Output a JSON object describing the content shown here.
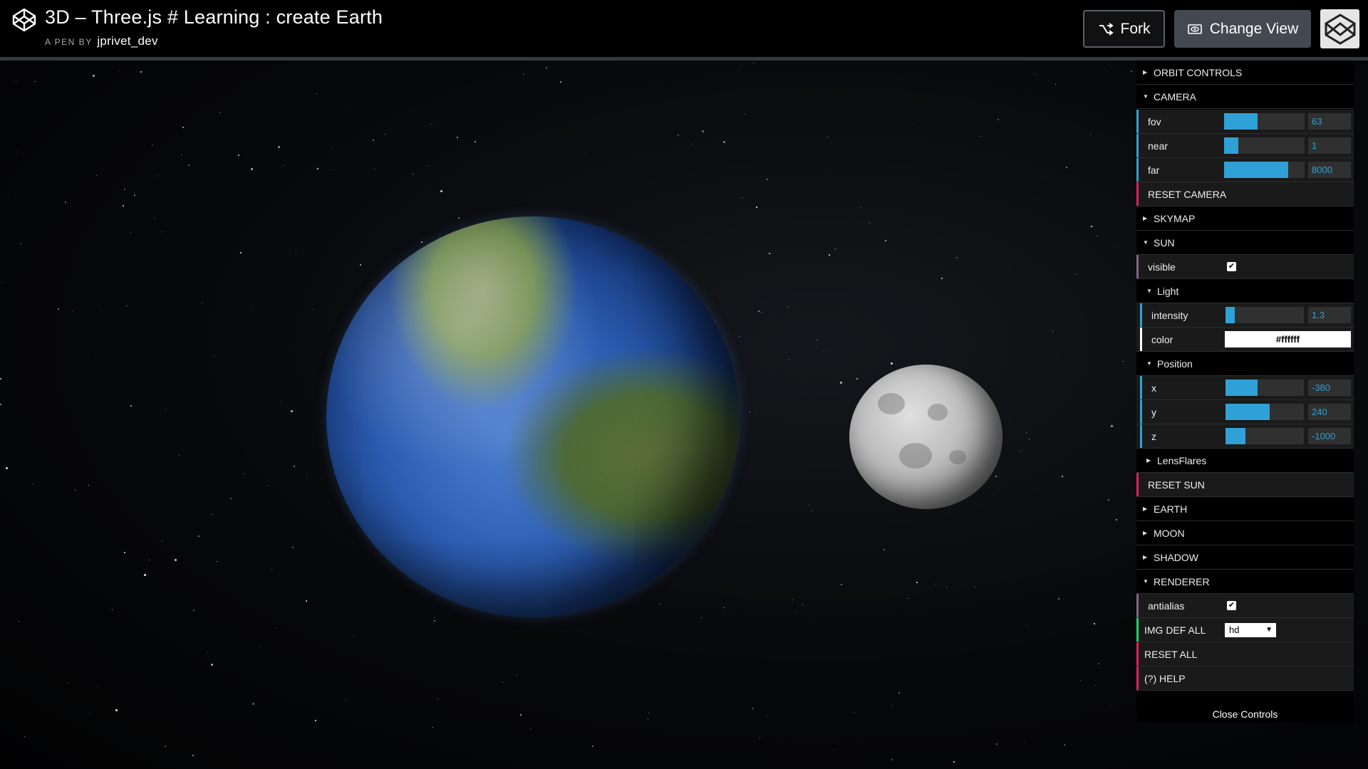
{
  "header": {
    "title": "3D – Three.js # Learning : create Earth",
    "byline_prefix": "A PEN BY",
    "author": "jprivet_dev",
    "fork_label": "Fork",
    "change_view_label": "Change View"
  },
  "gui": {
    "orbit_controls": "ORBIT CONTROLS",
    "camera": {
      "title": "CAMERA",
      "fov": {
        "label": "fov",
        "value": "63",
        "fill": 0.42
      },
      "near": {
        "label": "near",
        "value": "1",
        "fill": 0.18
      },
      "far": {
        "label": "far",
        "value": "8000",
        "fill": 0.8
      },
      "reset": "RESET CAMERA"
    },
    "skymap": "SKYMAP",
    "sun": {
      "title": "SUN",
      "visible": {
        "label": "visible",
        "checked": true
      },
      "light": {
        "title": "Light",
        "intensity": {
          "label": "intensity",
          "value": "1.3",
          "fill": 0.12
        },
        "color": {
          "label": "color",
          "value": "#ffffff"
        }
      },
      "position": {
        "title": "Position",
        "x": {
          "label": "x",
          "value": "-380",
          "fill": 0.41
        },
        "y": {
          "label": "y",
          "value": "240",
          "fill": 0.56
        },
        "z": {
          "label": "z",
          "value": "-1000",
          "fill": 0.25
        }
      },
      "lensflares": "LensFlares",
      "reset": "RESET SUN"
    },
    "earth": "EARTH",
    "moon": "MOON",
    "shadow": "SHADOW",
    "renderer": {
      "title": "RENDERER",
      "antialias": {
        "label": "antialias",
        "checked": true
      }
    },
    "img_def_all": {
      "label": "IMG DEF ALL",
      "value": "hd"
    },
    "reset_all": "RESET ALL",
    "help": "(?) HELP",
    "close": "Close Controls"
  },
  "colors": {
    "accent_blue": "#2fa1d6",
    "stripe_blue": "#2fa1d6",
    "stripe_pink": "#e61d5f",
    "stripe_green": "#1ed36f",
    "stripe_purple": "#806787"
  },
  "icons": [
    "codepen-logo-icon",
    "fork-icon",
    "eye-icon",
    "avatar-icon",
    "caret-right-icon",
    "caret-down-icon",
    "check-icon",
    "chevron-down-icon"
  ]
}
